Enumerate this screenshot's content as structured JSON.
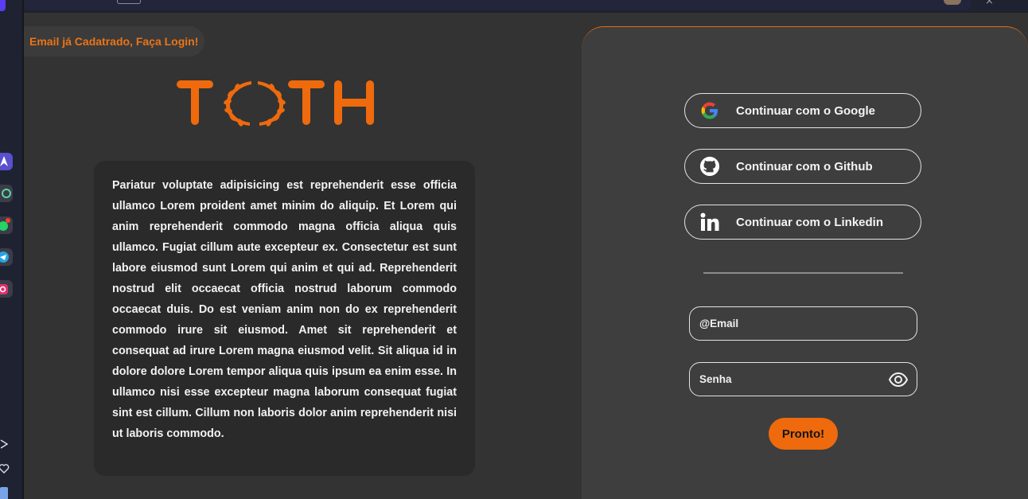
{
  "toast": {
    "message": "Email já Cadatrado, Faça Login!"
  },
  "brand": {
    "logo_text": "TOTH",
    "color": "#ef6a0c"
  },
  "description": {
    "text": "Pariatur voluptate adipisicing est reprehenderit esse officia ullamco Lorem proident amet minim do aliquip. Et Lorem qui anim reprehenderit commodo magna officia aliqua quis ullamco. Fugiat cillum aute excepteur ex. Consectetur est sunt labore eiusmod sunt Lorem qui anim et qui ad. Reprehenderit nostrud elit occaecat officia nostrud laborum commodo occaecat duis. Do est veniam anim non do ex reprehenderit commodo irure sit eiusmod. Amet sit reprehenderit et consequat ad irure Lorem magna eiusmod velit. Sit aliqua id in dolore dolore Lorem tempor aliqua quis ipsum ea enim esse. In ullamco nisi esse excepteur magna laborum consequat fugiat sint est cillum. Cillum non laboris dolor anim reprehenderit nisi ut laboris commodo."
  },
  "auth": {
    "oauth": [
      {
        "label": "Continuar com o Google",
        "icon": "google-icon"
      },
      {
        "label": "Continuar com o Github",
        "icon": "github-icon"
      },
      {
        "label": "Continuar com o Linkedin",
        "icon": "linkedin-icon"
      }
    ],
    "email_placeholder": "@Email",
    "password_placeholder": "Senha",
    "submit_label": "Pronto!",
    "accent": "#ef6a0c"
  },
  "dock": {
    "icons": [
      "app-icon",
      "chatgpt-icon",
      "whatsapp-icon",
      "telegram-icon",
      "instagram-icon",
      "play-icon",
      "heart-icon"
    ]
  }
}
